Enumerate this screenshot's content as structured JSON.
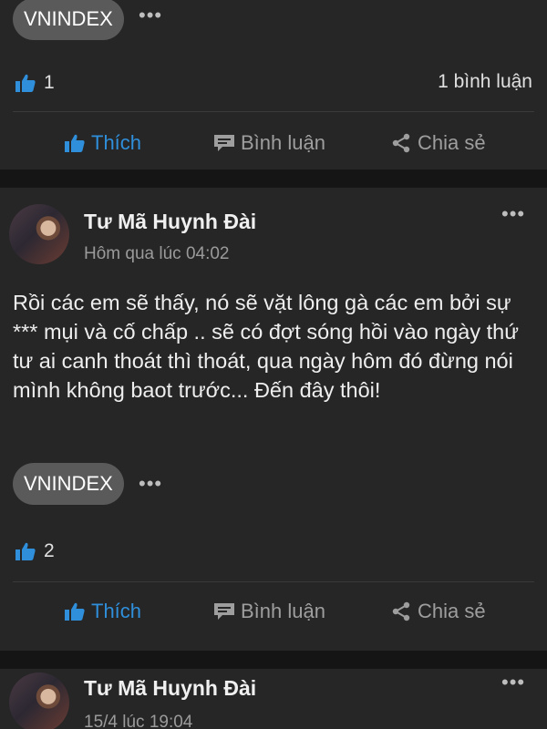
{
  "icons": {
    "like": "thumbs-up-icon",
    "comment": "chat-bubble-icon",
    "share": "share-icon",
    "more": "more-dots-icon"
  },
  "colors": {
    "accent": "#2f8fdb",
    "card": "#262626",
    "background": "#151515",
    "tag": "#5a5a5a"
  },
  "post1": {
    "tag": "VNINDEX",
    "like_count": "1",
    "comment_count": "1 bình luận",
    "actions": {
      "like": "Thích",
      "comment": "Bình luận",
      "share": "Chia sẻ"
    }
  },
  "post2": {
    "author": "Tư Mã Huynh Đài",
    "time": "Hôm qua lúc 04:02",
    "text": "Rồi các em sẽ thấy, nó sẽ vặt lông gà các em bởi sự *** mụi và cố chấp .. sẽ có đợt sóng hồi vào ngày thứ tư ai canh thoát thì thoát, qua ngày hôm đó đừng nói mình không baot trước... Đến đây thôi!",
    "tag": "VNINDEX",
    "like_count": "2",
    "actions": {
      "like": "Thích",
      "comment": "Bình luận",
      "share": "Chia sẻ"
    }
  },
  "post3": {
    "author": "Tư Mã Huynh Đài",
    "time": "15/4 lúc 19:04"
  }
}
